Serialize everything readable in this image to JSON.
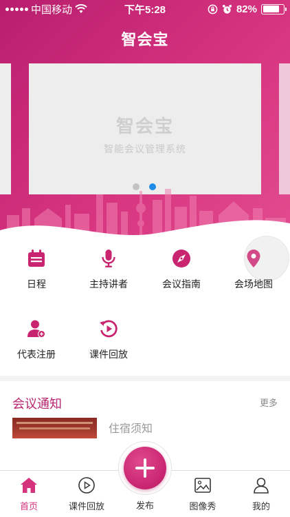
{
  "status_bar": {
    "carrier": "中国移动",
    "time": "下午5:28",
    "battery_percent": "82%",
    "battery_level": 0.82
  },
  "app": {
    "title": "智会宝"
  },
  "banner": {
    "title": "智会宝",
    "subtitle": "智能会议管理系统",
    "page_count": 2,
    "active_page": 2
  },
  "menu": {
    "items": [
      {
        "label": "日程",
        "icon": "calendar-icon"
      },
      {
        "label": "主持讲者",
        "icon": "microphone-icon"
      },
      {
        "label": "会议指南",
        "icon": "compass-icon"
      },
      {
        "label": "会场地图",
        "icon": "map-pin-icon"
      },
      {
        "label": "代表注册",
        "icon": "user-add-icon"
      },
      {
        "label": "课件回放",
        "icon": "replay-icon"
      }
    ]
  },
  "notice": {
    "title": "会议通知",
    "more": "更多",
    "items": [
      {
        "title": "住宿须知"
      }
    ]
  },
  "tabbar": {
    "items": [
      {
        "label": "首页",
        "icon": "home-icon",
        "active": true
      },
      {
        "label": "课件回放",
        "icon": "play-circle-icon",
        "active": false
      },
      {
        "label": "发布",
        "icon": "plus-icon",
        "active": false
      },
      {
        "label": "图像秀",
        "icon": "image-icon",
        "active": false
      },
      {
        "label": "我的",
        "icon": "user-icon",
        "active": false
      }
    ]
  },
  "colors": {
    "brand": "#c8246f",
    "brand_light": "#e24c8f",
    "active_dot": "#1f8be6",
    "icon": "#c8246f"
  }
}
